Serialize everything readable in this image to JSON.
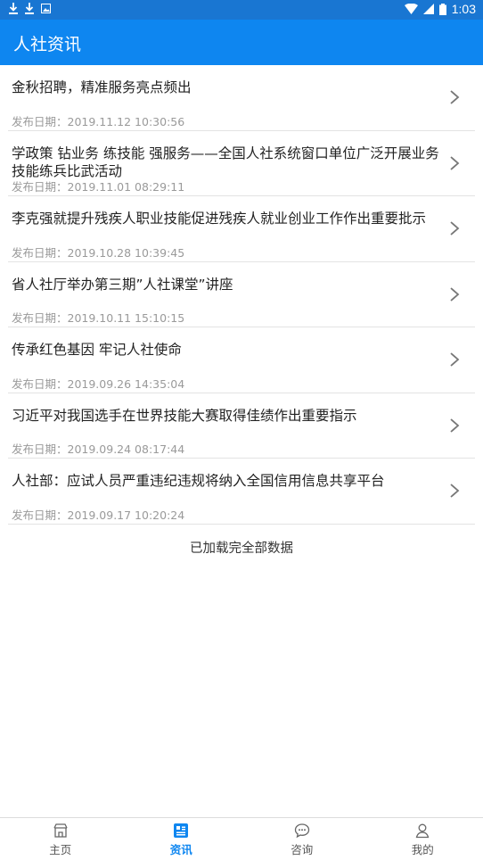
{
  "status_bar": {
    "time": "1:03"
  },
  "app_bar": {
    "title": "人社资讯"
  },
  "news": [
    {
      "title": "金秋招聘，精准服务亮点频出",
      "date": "发布日期：2019.11.12 10:30:56"
    },
    {
      "title": "学政策 钻业务 练技能 强服务——全国人社系统窗口单位广泛开展业务技能练兵比武活动",
      "date": "发布日期：2019.11.01 08:29:11"
    },
    {
      "title": "李克强就提升残疾人职业技能促进残疾人就业创业工作作出重要批示",
      "date": "发布日期：2019.10.28 10:39:45"
    },
    {
      "title": "省人社厅举办第三期”人社课堂”讲座",
      "date": "发布日期：2019.10.11 15:10:15"
    },
    {
      "title": "传承红色基因 牢记人社使命",
      "date": "发布日期：2019.09.26 14:35:04"
    },
    {
      "title": "习近平对我国选手在世界技能大赛取得佳绩作出重要指示",
      "date": "发布日期：2019.09.24 08:17:44"
    },
    {
      "title": "人社部：应试人员严重违纪违规将纳入全国信用信息共享平台",
      "date": "发布日期：2019.09.17 10:20:24"
    }
  ],
  "list_footer": "已加载完全部数据",
  "tabs": [
    {
      "label": "主页",
      "icon": "home-icon"
    },
    {
      "label": "资讯",
      "icon": "news-icon",
      "active": true
    },
    {
      "label": "咨询",
      "icon": "chat-icon"
    },
    {
      "label": "我的",
      "icon": "user-icon"
    }
  ],
  "colors": {
    "primary": "#0e86f0",
    "statusbar": "#1976d2"
  }
}
